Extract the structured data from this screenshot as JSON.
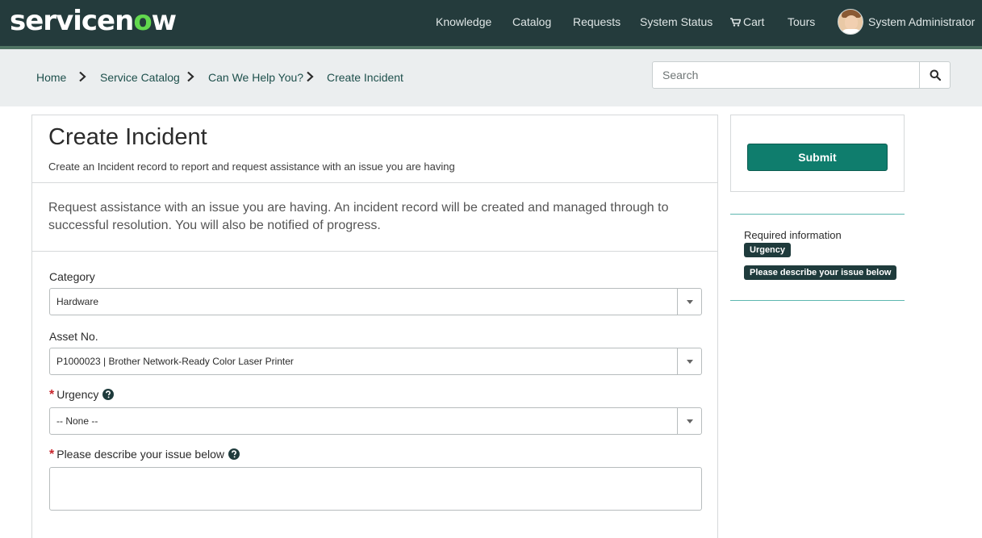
{
  "app": {
    "logo_prefix": "servicen",
    "logo_o": "o",
    "logo_suffix": "w"
  },
  "nav": {
    "items": [
      {
        "label": "Knowledge"
      },
      {
        "label": "Catalog"
      },
      {
        "label": "Requests"
      },
      {
        "label": "System Status"
      },
      {
        "label": "Cart",
        "icon": "cart-icon"
      },
      {
        "label": "Tours"
      }
    ],
    "user_name": "System Administrator"
  },
  "breadcrumb": {
    "items": [
      {
        "label": "Home"
      },
      {
        "label": "Service Catalog"
      },
      {
        "label": "Can We Help You?"
      },
      {
        "label": "Create Incident"
      }
    ]
  },
  "search": {
    "placeholder": "Search",
    "icon": "search-icon"
  },
  "form": {
    "title": "Create Incident",
    "subtitle": "Create an Incident record to report and request assistance with an issue you are having",
    "intro": "Request assistance with an issue you are having. An incident record will be created and managed through to successful resolution. You will also be notified of progress.",
    "fields": {
      "category": {
        "label": "Category",
        "value": "Hardware"
      },
      "asset": {
        "label": "Asset No.",
        "value": "P1000023 | Brother Network-Ready Color Laser Printer"
      },
      "urgency": {
        "label": "Urgency",
        "value": "-- None --",
        "required": true
      },
      "description": {
        "label": "Please describe your issue below",
        "value": "",
        "required": true
      }
    },
    "required_mark": "*"
  },
  "sidebar": {
    "submit_label": "Submit",
    "required_title": "Required information",
    "required_items": [
      "Urgency",
      "Please describe your issue below"
    ]
  },
  "colors": {
    "header_bg": "#243b3c",
    "accent_green": "#0f7d6d",
    "link": "#1d4f4b",
    "required_red": "#c8252c"
  }
}
